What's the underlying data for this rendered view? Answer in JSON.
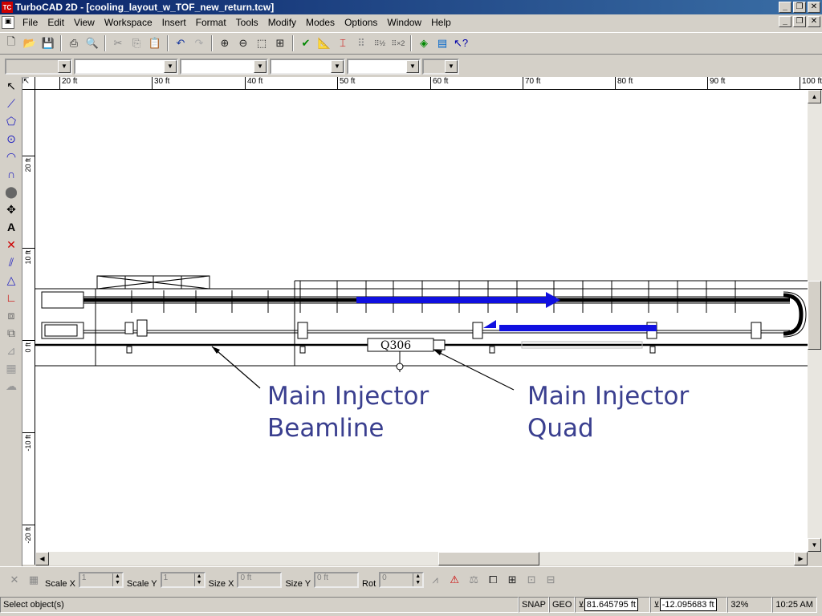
{
  "window": {
    "title": "TurboCAD 2D - [cooling_layout_w_TOF_new_return.tcw]",
    "app_icon": "TC",
    "buttons": [
      "_",
      "❐",
      "✕"
    ]
  },
  "menubar": {
    "items": [
      "File",
      "Edit",
      "View",
      "Workspace",
      "Insert",
      "Format",
      "Tools",
      "Modify",
      "Modes",
      "Options",
      "Window",
      "Help"
    ]
  },
  "toolbar": {
    "icons": [
      "new-file-icon",
      "open-folder-icon",
      "save-icon",
      "print-icon",
      "print-preview-icon",
      "cut-icon",
      "copy-icon",
      "paste-icon",
      "undo-icon",
      "redo-icon",
      "zoom-in-icon",
      "zoom-out-icon",
      "zoom-window-icon",
      "zoom-extents-icon",
      "snap-icon",
      "measure-icon",
      "dimension-icon",
      "grid-icon",
      "grid-half-icon",
      "grid-double-icon",
      "layers-icon",
      "properties-icon",
      "help-pointer-icon"
    ]
  },
  "rulers": {
    "horizontal": [
      "20 ft",
      "30 ft",
      "40 ft",
      "50 ft",
      "60 ft",
      "70 ft",
      "80 ft",
      "90 ft",
      "100 ft"
    ],
    "vertical": [
      "20 ft",
      "10 ft",
      "0 ft",
      "-10 ft",
      "-20 ft"
    ]
  },
  "drawing": {
    "label_beamline": "Main Injector\nBeamline",
    "label_beamline_l1": "Main Injector",
    "label_beamline_l2": "Beamline",
    "label_quad_l1": "Main Injector",
    "label_quad_l2": "Quad",
    "quad_id": "Q306",
    "label_color": "#3a3f8f",
    "arrow_color": "#1010e0"
  },
  "bottombar": {
    "scale_x_label": "Scale X",
    "scale_x_value": "1",
    "scale_y_label": "Scale Y",
    "scale_y_value": "1",
    "size_x_label": "Size X",
    "size_x_value": "0 ft",
    "size_y_label": "Size Y",
    "size_y_value": "0 ft",
    "rot_label": "Rot",
    "rot_value": "0"
  },
  "statusbar": {
    "message": "Select object(s)",
    "snap": "SNAP",
    "geo": "GEO",
    "x_coord": "81.645795 ft",
    "y_coord": "-12.095683 ft",
    "zoom": "32%",
    "time": "10:25 AM"
  }
}
